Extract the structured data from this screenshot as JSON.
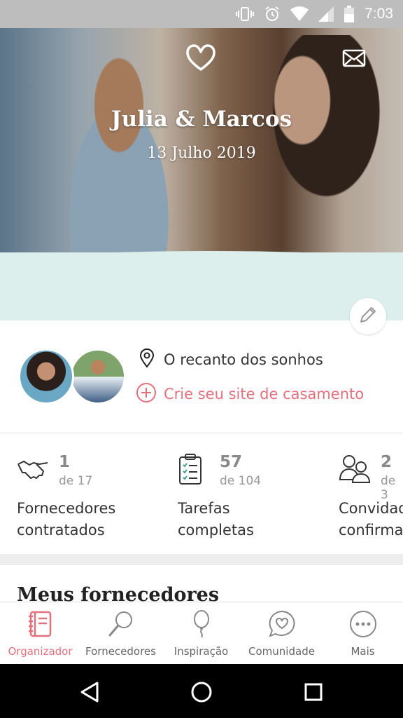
{
  "status_bar": {
    "time": "7:03",
    "icons": [
      "vibrate-icon",
      "alarm-icon",
      "wifi-icon",
      "signal-icon",
      "battery-icon"
    ]
  },
  "hero": {
    "couple_names": "Julia & Marcos",
    "wedding_date": "13 Julho 2019",
    "icons": [
      "heart-logo-icon",
      "mail-icon",
      "pencil-icon"
    ]
  },
  "profile": {
    "venue": "O recanto dos sonhos",
    "create_site_label": "Crie seu site de casamento",
    "accent_color": "#e4707c"
  },
  "stats": [
    {
      "icon": "handshake-icon",
      "count": "1",
      "total": "de 17",
      "label_line1": "Fornecedores",
      "label_line2": "contratados"
    },
    {
      "icon": "clipboard-checklist-icon",
      "count": "57",
      "total": "de 104",
      "label_line1": "Tarefas",
      "label_line2": "completas"
    },
    {
      "icon": "guests-icon",
      "count": "2",
      "total": "de 3",
      "label_line1": "Convidados",
      "label_line2": "confirmados"
    }
  ],
  "section": {
    "title": "Meus fornecedores"
  },
  "tabs": [
    {
      "label": "Organizador",
      "icon": "notebook-icon",
      "active": true
    },
    {
      "label": "Fornecedores",
      "icon": "magnifier-icon",
      "active": false
    },
    {
      "label": "Inspiração",
      "icon": "balloon-icon",
      "active": false
    },
    {
      "label": "Comunidade",
      "icon": "chat-heart-icon",
      "active": false
    },
    {
      "label": "Mais",
      "icon": "more-dots-icon",
      "active": false
    }
  ],
  "nav_bar": {
    "icons": [
      "back-icon",
      "home-icon",
      "recents-icon"
    ]
  }
}
